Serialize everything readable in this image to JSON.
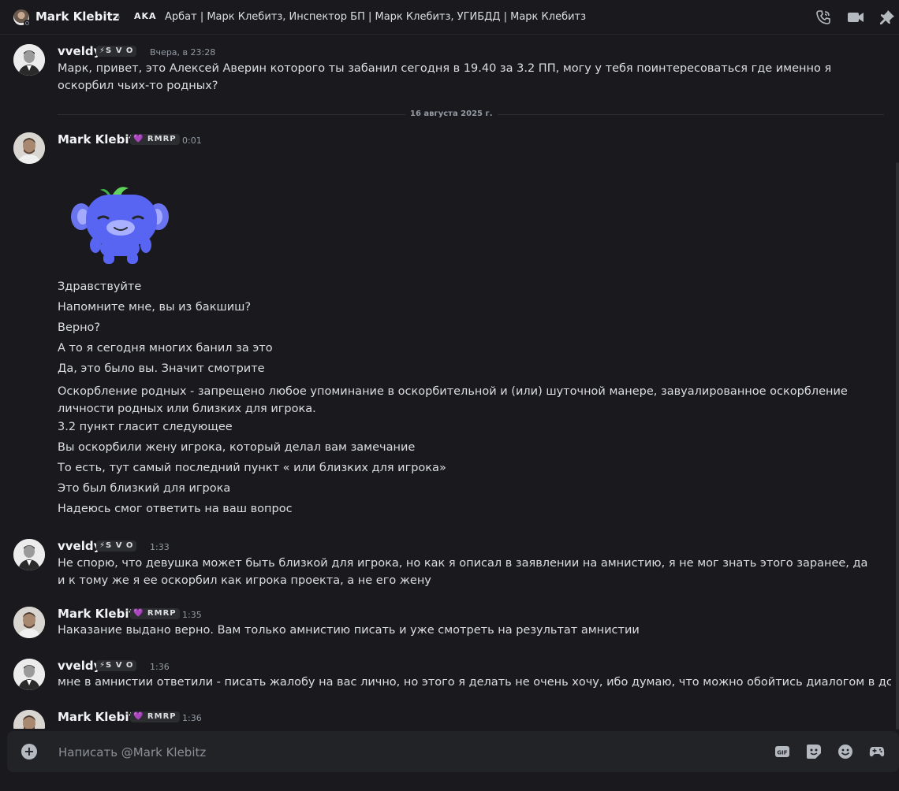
{
  "header": {
    "name": "Mark Klebitz",
    "tag": "AKA",
    "status_text": "Арбат | Марк Клебитз, Инспектор БП | Марк Клебитз, УГИБДД | Марк Клебитз"
  },
  "icons": {
    "call": "phone-call-icon",
    "video": "video-camera-icon",
    "pin": "pin-icon",
    "add": "plus-circle-icon",
    "gif": "gif-icon",
    "sticker": "sticker-icon",
    "emoji": "emoji-icon",
    "game": "gamepad-icon"
  },
  "badges": {
    "vveldy": "⚡S V O",
    "mark": "💜 RMRP"
  },
  "messages": [
    {
      "author": "vveldy",
      "time": "Вчера, в 23:28",
      "text": "Марк, привет, это Алексей Аверин которого ты забанил сегодня в 19.40 за 3.2 ПП, могу у тебя поинтересоваться где именно я оскорбил чьих-то родных?"
    },
    {
      "date_divider": "16 августа 2025 г."
    },
    {
      "author": "Mark Klebitz",
      "time": "0:01",
      "lines": [
        "Здравствуйте",
        "Напомните мне,  вы из бакшиш?",
        "Верно?",
        "А то я сегодня многих банил за это",
        "Да, это было вы. Значит смотрите",
        "Оскорбление родных - запрещено любое упоминание в оскорбительной и (или) шуточной манере, завуалированное оскорбление личности родных или близких для игрока.",
        "3.2 пункт гласит следующее",
        "Вы оскорбили жену игрока, который делал вам замечание",
        "То есть, тут самый последний пункт « или близких для игрока»",
        "Это был близкий для игрока",
        "Надеюсь смог ответить на ваш вопрос"
      ]
    },
    {
      "author": "vveldy",
      "time": "1:33",
      "text": "Не спорю, что девушка может быть близкой для игрока, но как я описал в заявлении на амнистию, я не мог знать этого заранее, да и к тому же я ее оскорбил как игрока проекта, а не его жену"
    },
    {
      "author": "Mark Klebitz",
      "time": "1:35",
      "text": "Наказание выдано верно. Вам только амнистию писать и уже смотреть на результат амнистии"
    },
    {
      "author": "vveldy",
      "time": "1:36",
      "text": "мне в амнистии ответили - писать жалобу на вас лично, но этого я делать не очень хочу, ибо думаю, что можно обойтись диалогом в дс"
    },
    {
      "author": "Mark Klebitz",
      "time": "1:36"
    }
  ],
  "composer": {
    "placeholder": "Написать @Mark Klebitz",
    "gif_label": "GIF"
  }
}
